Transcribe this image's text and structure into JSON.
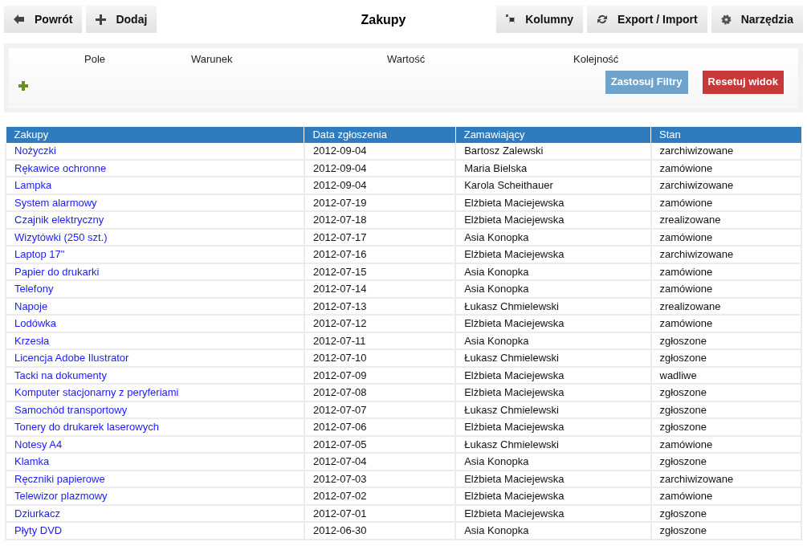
{
  "toolbar": {
    "left": [
      {
        "kind": "back",
        "label": "Powrót"
      },
      {
        "kind": "add",
        "label": "Dodaj"
      }
    ],
    "title": "Zakupy",
    "right": [
      {
        "kind": "columns",
        "label": "Kolumny"
      },
      {
        "kind": "sync",
        "label": "Export / Import"
      },
      {
        "kind": "gear",
        "label": "Narzędzia"
      }
    ]
  },
  "filters": {
    "headers": [
      "Pole",
      "Warunek",
      "Wartość",
      "Kolejność"
    ],
    "apply": "Zastosuj Filtry",
    "reset": "Resetuj widok"
  },
  "table": {
    "columns": [
      "Zakupy",
      "Data zgłoszenia",
      "Zamawiający",
      "Stan"
    ],
    "rows": [
      [
        "Nożyczki",
        "2012-09-04",
        "Bartosz Zalewski",
        "zarchiwizowane"
      ],
      [
        "Rękawice ochronne",
        "2012-09-04",
        "Maria Bielska",
        "zamówione"
      ],
      [
        "Lampka",
        "2012-09-04",
        "Karola Scheithauer",
        "zarchiwizowane"
      ],
      [
        "System alarmowy",
        "2012-07-19",
        "Elżbieta Maciejewska",
        "zamówione"
      ],
      [
        "Czajnik elektryczny",
        "2012-07-18",
        "Elżbieta Maciejewska",
        "zrealizowane"
      ],
      [
        "Wizytówki (250 szt.)",
        "2012-07-17",
        "Asia Konopka",
        "zamówione"
      ],
      [
        "Laptop 17\"",
        "2012-07-16",
        "Elżbieta Maciejewska",
        "zarchiwizowane"
      ],
      [
        "Papier do drukarki",
        "2012-07-15",
        "Asia Konopka",
        "zamówione"
      ],
      [
        "Telefony",
        "2012-07-14",
        "Asia Konopka",
        "zamówione"
      ],
      [
        "Napoje",
        "2012-07-13",
        "Łukasz Chmielewski",
        "zrealizowane"
      ],
      [
        "Lodówka",
        "2012-07-12",
        "Elżbieta Maciejewska",
        "zamówione"
      ],
      [
        "Krzesła",
        "2012-07-11",
        "Asia Konopka",
        "zgłoszone"
      ],
      [
        "Licencja Adobe Ilustrator",
        "2012-07-10",
        "Łukasz Chmielewski",
        "zgłoszone"
      ],
      [
        "Tacki na dokumenty",
        "2012-07-09",
        "Elżbieta Maciejewska",
        "wadliwe"
      ],
      [
        "Komputer stacjonarny z peryferiami",
        "2012-07-08",
        "Elżbieta Maciejewska",
        "zgłoszone"
      ],
      [
        "Samochód transportowy",
        "2012-07-07",
        "Łukasz Chmielewski",
        "zgłoszone"
      ],
      [
        "Tonery do drukarek laserowych",
        "2012-07-06",
        "Elżbieta Maciejewska",
        "zgłoszone"
      ],
      [
        "Notesy A4",
        "2012-07-05",
        "Łukasz Chmielewski",
        "zamówione"
      ],
      [
        "Klamka",
        "2012-07-04",
        "Asia Konopka",
        "zgłoszone"
      ],
      [
        "Ręczniki papierowe",
        "2012-07-03",
        "Elżbieta Maciejewska",
        "zarchiwizowane"
      ],
      [
        "Telewizor plazmowy",
        "2012-07-02",
        "Elżbieta Maciejewska",
        "zamówione"
      ],
      [
        "Dziurkacz",
        "2012-07-01",
        "Elżbieta Maciejewska",
        "zgłoszone"
      ],
      [
        "Płyty DVD",
        "2012-06-30",
        "Asia Konopka",
        "zgłoszone"
      ]
    ]
  }
}
